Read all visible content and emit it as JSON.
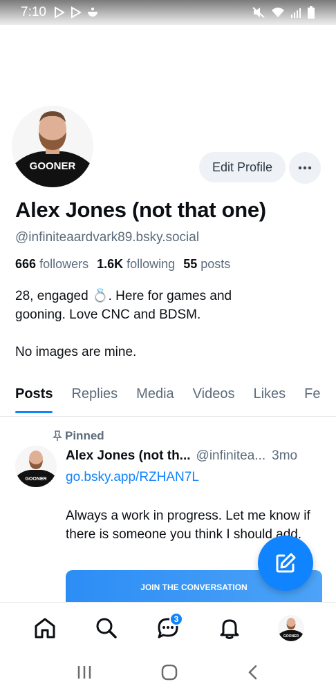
{
  "status_bar": {
    "time": "7:10"
  },
  "profile": {
    "display_name": "Alex Jones (not that one)",
    "handle": "@infiniteaardvark89.bsky.social",
    "avatar_shirt_text": "GOONER",
    "edit_button": "Edit Profile",
    "stats": {
      "followers_count": "666",
      "followers_label": "followers",
      "following_count": "1.6K",
      "following_label": "following",
      "posts_count": "55",
      "posts_label": "posts"
    },
    "bio": "28, engaged 💍.  Here for games and\ngooning. Love CNC and BDSM.\n\nNo images are mine."
  },
  "tabs": [
    {
      "label": "Posts",
      "active": true
    },
    {
      "label": "Replies"
    },
    {
      "label": "Media"
    },
    {
      "label": "Videos"
    },
    {
      "label": "Likes"
    },
    {
      "label": "Fe"
    }
  ],
  "post": {
    "pinned_label": "Pinned",
    "author": "Alex Jones (not th...",
    "handle": "@infinitea...",
    "time": "3mo",
    "link": "go.bsky.app/RZHAN7L",
    "text": "Always a work in progress. Let me know if there is someone you think I should add.",
    "embed_text": "JOIN THE CONVERSATION"
  },
  "bottom_nav": {
    "messages_badge": "3"
  },
  "colors": {
    "accent": "#1083fe",
    "muted": "#5b6b7c"
  }
}
